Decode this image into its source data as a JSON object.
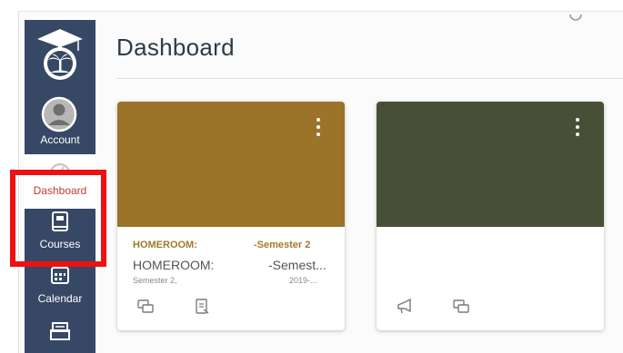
{
  "nav": {
    "account_label": "Account",
    "dashboard_label": "Dashboard",
    "courses_label": "Courses",
    "calendar_label": "Calendar"
  },
  "header": {
    "title": "Dashboard"
  },
  "cards": [
    {
      "color": "#9b742a",
      "course_code": "HOMEROOM:",
      "course_code_suffix": "-Semester 2",
      "title": "HOMEROOM:",
      "title_suffix": "-Semest...",
      "term": "Semester 2,",
      "term_suffix": "2019-..."
    },
    {
      "color": "#474f37"
    }
  ],
  "colors": {
    "sidebar": "#364865",
    "active_nav_text": "#c23b2f",
    "highlight": "#ee1111"
  }
}
